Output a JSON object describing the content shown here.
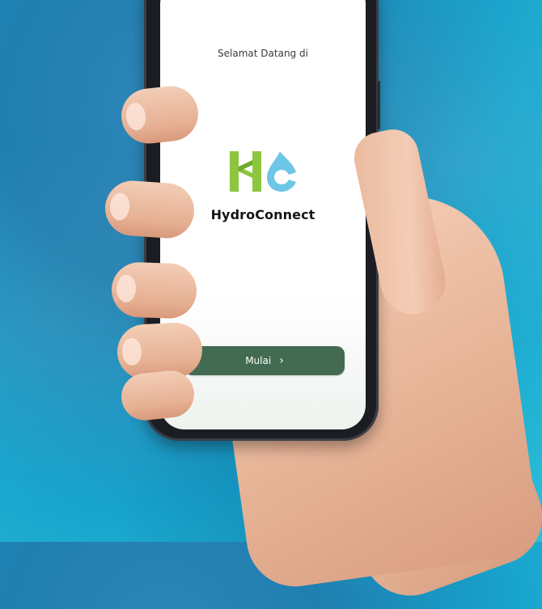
{
  "screen": {
    "welcome_text": "Selamat Datang di",
    "brand_name": "HydroConnect",
    "logo_letters": "HC",
    "start_button_label": "Mulai",
    "start_button_icon": "chevron-right-icon",
    "start_button_glyph": "›"
  },
  "colors": {
    "button_green": "#426b52",
    "logo_green": "#8cc63f",
    "logo_blue": "#6ec6e6",
    "background_blue": "#1f8fc0"
  }
}
